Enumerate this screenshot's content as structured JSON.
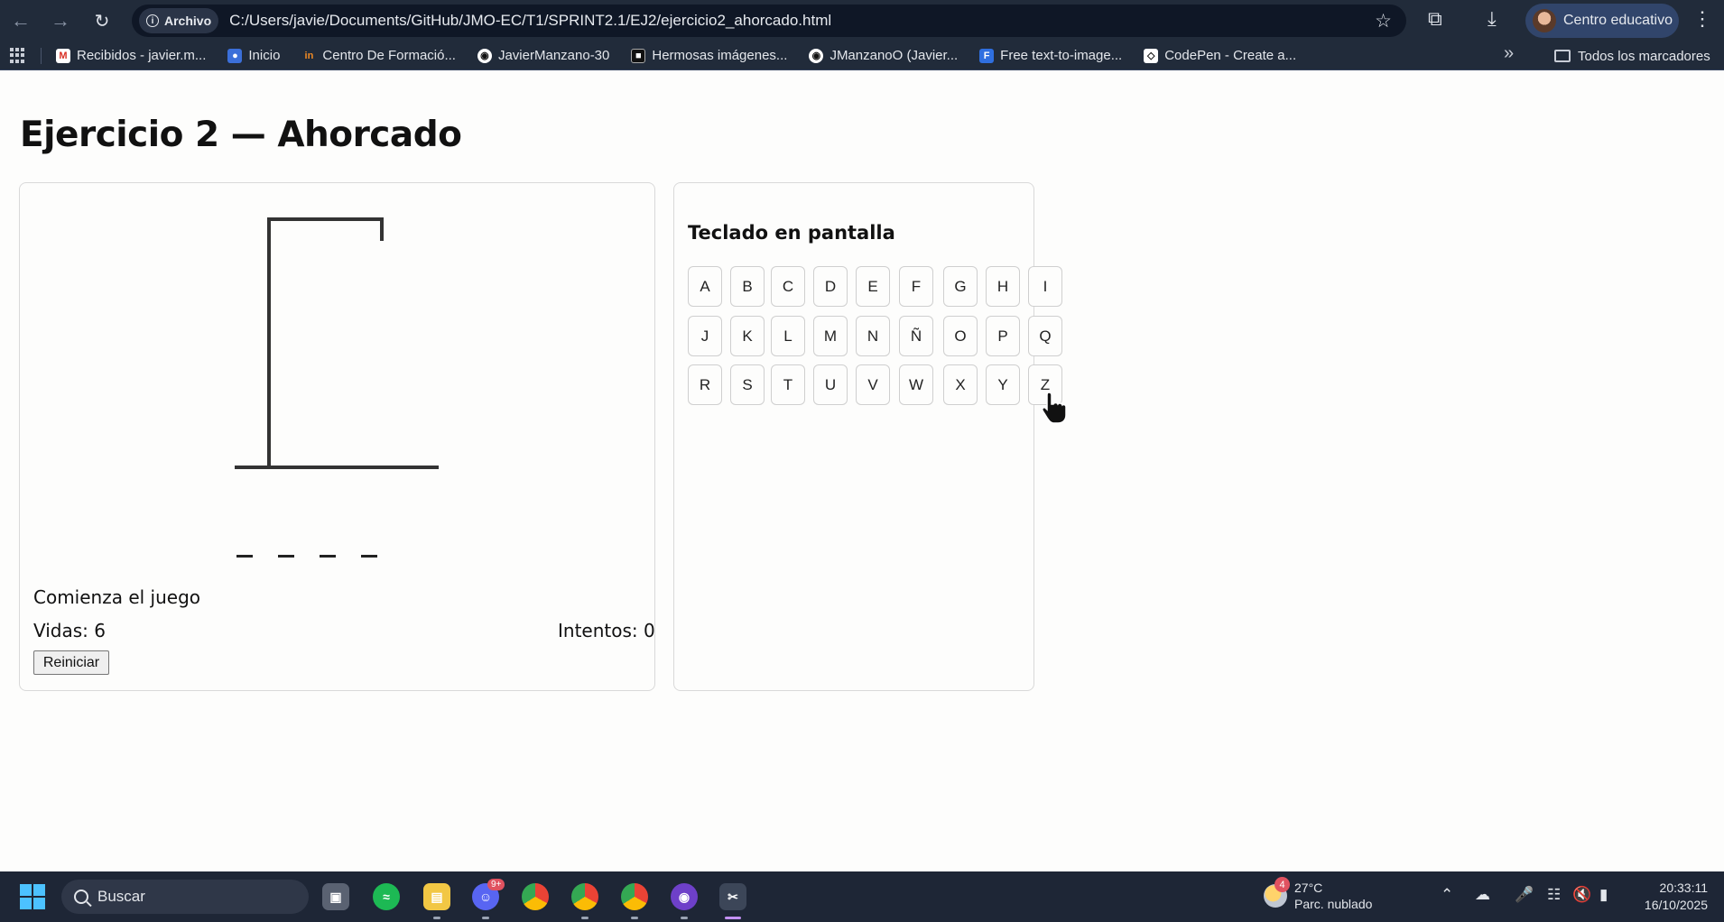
{
  "browser": {
    "address_badge": "Archivo",
    "url": "C:/Users/javie/Documents/GitHub/JMO-EC/T1/SPRINT2.1/EJ2/ejercicio2_ahorcado.html",
    "profile_label": "Centro educativo",
    "bookmarks": [
      {
        "label": "Recibidos - javier.m...",
        "icon": "gmail-icon"
      },
      {
        "label": "Inicio",
        "icon": "user-icon"
      },
      {
        "label": "Centro De Formació...",
        "icon": "formacion-icon"
      },
      {
        "label": "JavierManzano-30",
        "icon": "github-icon"
      },
      {
        "label": "Hermosas imágenes...",
        "icon": "unsplash-icon"
      },
      {
        "label": "JManzanoO (Javier...",
        "icon": "github-icon"
      },
      {
        "label": "Free text-to-image...",
        "icon": "freepik-icon"
      },
      {
        "label": "CodePen - Create a...",
        "icon": "codepen-icon"
      }
    ],
    "all_bookmarks_label": "Todos los marcadores"
  },
  "page": {
    "title": "Ejercicio 2 — Ahorcado",
    "game": {
      "word_slots": [
        "_",
        "_",
        "_",
        "_"
      ],
      "message": "Comienza el juego",
      "lives": "Vidas: 6",
      "attempts": "Intentos: 0",
      "reset_label": "Reiniciar"
    },
    "keyboard": {
      "title": "Teclado en pantalla",
      "rows": [
        [
          "A",
          "B",
          "C",
          "D",
          "E",
          "F",
          "G",
          "H",
          "I"
        ],
        [
          "J",
          "K",
          "L",
          "M",
          "N",
          "Ñ",
          "O",
          "P",
          "Q"
        ],
        [
          "R",
          "S",
          "T",
          "U",
          "V",
          "W",
          "X",
          "Y",
          "Z"
        ]
      ]
    }
  },
  "taskbar": {
    "search_placeholder": "Buscar",
    "weather_badge": "4",
    "weather_temp": "27°C",
    "weather_desc": "Parc. nublado",
    "notification_badge": "9+",
    "time": "20:33:11",
    "date": "16/10/2025"
  }
}
